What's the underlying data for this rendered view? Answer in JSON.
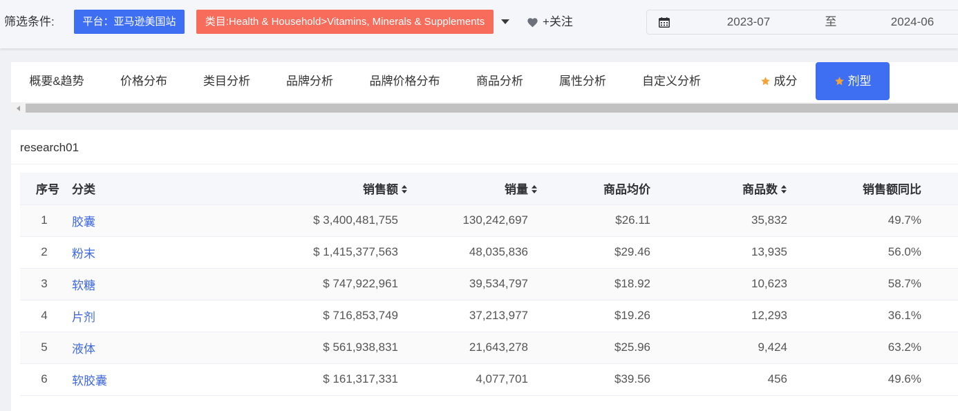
{
  "filter_bar": {
    "label": "筛选条件:",
    "platform_tag": "平台：亚马逊美国站",
    "category_tag": "类目:Health & Household>Vitamins, Minerals & Supplements",
    "follow_label": "+关注",
    "date_range": {
      "start": "2023-07",
      "separator": "至",
      "end": "2024-06"
    }
  },
  "tabs": [
    {
      "label": "概要&趋势"
    },
    {
      "label": "价格分布"
    },
    {
      "label": "类目分析"
    },
    {
      "label": "品牌分析"
    },
    {
      "label": "品牌价格分布"
    },
    {
      "label": "商品分析"
    },
    {
      "label": "属性分析"
    },
    {
      "label": "自定义分析"
    },
    {
      "label": "成分",
      "icon": "star-icon"
    },
    {
      "label": "剂型",
      "icon": "star-icon",
      "active": true
    }
  ],
  "report": {
    "title": "research01",
    "table": {
      "columns": [
        {
          "label": "序号"
        },
        {
          "label": "分类"
        },
        {
          "label": "销售额",
          "sortable": true
        },
        {
          "label": "销量",
          "sortable": true
        },
        {
          "label": "商品均价"
        },
        {
          "label": "商品数",
          "sortable": true
        },
        {
          "label": "销售额同比"
        }
      ],
      "rows": [
        {
          "index": "1",
          "category": "胶囊",
          "sales": "$ 3,400,481,755",
          "volume": "130,242,697",
          "avg_price": "$26.11",
          "product_count": "35,832",
          "sales_yoy": "49.7%"
        },
        {
          "index": "2",
          "category": "粉末",
          "sales": "$ 1,415,377,563",
          "volume": "48,035,836",
          "avg_price": "$29.46",
          "product_count": "13,935",
          "sales_yoy": "56.0%"
        },
        {
          "index": "3",
          "category": "软糖",
          "sales": "$ 747,922,961",
          "volume": "39,534,797",
          "avg_price": "$18.92",
          "product_count": "10,623",
          "sales_yoy": "58.7%"
        },
        {
          "index": "4",
          "category": "片剂",
          "sales": "$ 716,853,749",
          "volume": "37,213,977",
          "avg_price": "$19.26",
          "product_count": "12,293",
          "sales_yoy": "36.1%"
        },
        {
          "index": "5",
          "category": "液体",
          "sales": "$ 561,938,831",
          "volume": "21,643,278",
          "avg_price": "$25.96",
          "product_count": "9,424",
          "sales_yoy": "63.2%"
        },
        {
          "index": "6",
          "category": "软胶囊",
          "sales": "$ 161,317,331",
          "volume": "4,077,701",
          "avg_price": "$39.56",
          "product_count": "456",
          "sales_yoy": "49.6%"
        }
      ]
    }
  },
  "icons": {
    "category_dropdown": "caret-down-icon",
    "follow": "heart-icon",
    "date_picker": "calendar-icon",
    "tab_badge": "star-icon",
    "sort": "sort-caret-icon",
    "scroll_left": "arrow-left-icon"
  },
  "colors": {
    "primary": "#3e6ff2",
    "category_tag": "#f76c5b",
    "link": "#3f68dc",
    "star": "#f2a43a"
  }
}
